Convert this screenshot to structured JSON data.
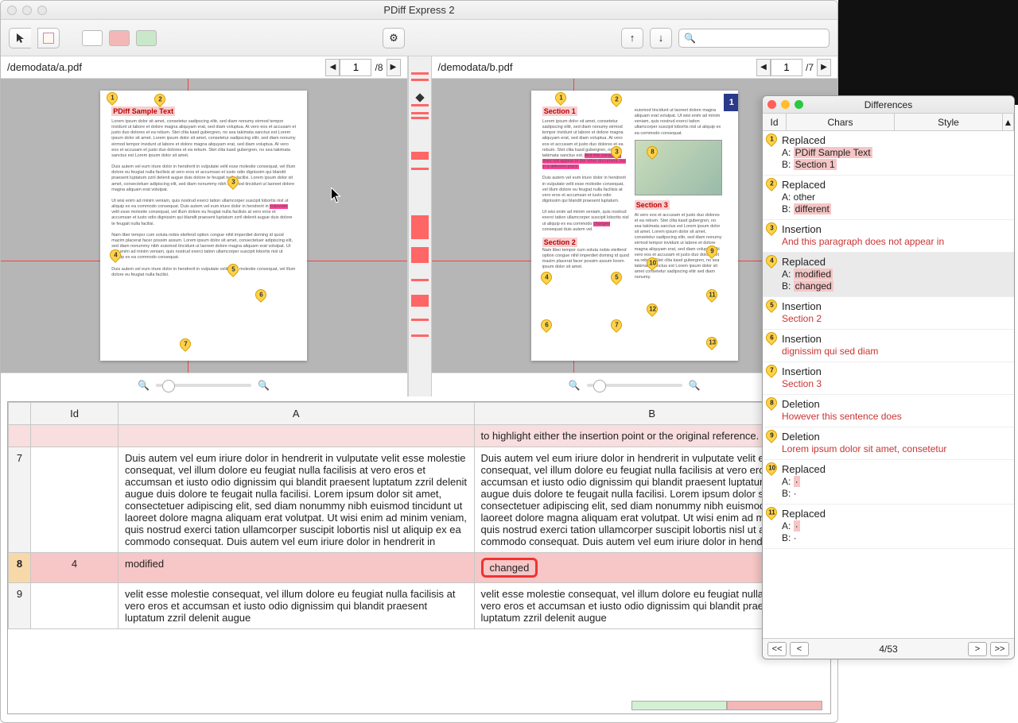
{
  "window": {
    "title": "PDiff Express 2"
  },
  "toolbar": {
    "swatches": [
      "#ffffff",
      "#f4b7b7",
      "#c9e8c9"
    ],
    "search_placeholder": ""
  },
  "docA": {
    "path": "/demodata/a.pdf",
    "page": "1",
    "total": "/8",
    "title": "PDiff Sample Text"
  },
  "docB": {
    "path": "/demodata/b.pdf",
    "page": "1",
    "total": "/7",
    "titles": [
      "Section 1",
      "Section 2",
      "Section 3"
    ]
  },
  "markersA": [
    1,
    2,
    3,
    4,
    5,
    6,
    7
  ],
  "markersB": [
    1,
    2,
    3,
    4,
    5,
    6,
    7,
    8,
    9,
    10,
    11,
    12,
    13
  ],
  "table": {
    "headers": {
      "id": "Id",
      "a": "A",
      "b": "B"
    },
    "rows": [
      {
        "num": "",
        "id": "",
        "a": "",
        "b": "to highlight either the insertion point or the original reference.",
        "cls": "pink"
      },
      {
        "num": "7",
        "id": "",
        "a": "Duis autem vel eum iriure dolor in hendrerit in vulputate velit esse molestie consequat, vel illum dolore eu feugiat nulla facilisis at vero eros et accumsan et iusto odio dignissim qui blandit praesent luptatum zzril delenit augue duis dolore te feugait nulla facilisi. Lorem ipsum dolor sit amet, consectetuer adipiscing elit, sed diam nonummy nibh euismod tincidunt ut laoreet dolore magna aliquam erat volutpat. Ut wisi enim ad minim veniam, quis nostrud exerci tation ullamcorper suscipit lobortis nisl ut aliquip ex ea commodo consequat. Duis autem vel eum iriure dolor in hendrerit in",
        "b": "Duis autem vel eum iriure dolor in hendrerit in vulputate velit esse molestie consequat, vel illum dolore eu feugiat nulla facilisis at vero eros et accumsan et iusto odio dignissim qui blandit praesent luptatum zzril delenit augue duis dolore te feugait nulla facilisi. Lorem ipsum dolor sit amet, consectetuer adipiscing elit, sed diam nonummy nibh euismod tincidunt ut laoreet dolore magna aliquam erat volutpat. Ut wisi enim ad minim veniam, quis nostrud exerci tation ullamcorper suscipit lobortis nisl ut aliquip ex ea commodo consequat. Duis autem vel eum iriure dolor in hendrerit in",
        "cls": ""
      },
      {
        "num": "8",
        "id": "4",
        "a": "modified",
        "b": "changed",
        "cls": "selected"
      },
      {
        "num": "9",
        "id": "",
        "a": "velit esse molestie consequat, vel illum dolore eu feugiat nulla facilisis at vero eros et accumsan et iusto odio dignissim qui blandit praesent luptatum zzril delenit augue",
        "b": "velit esse molestie consequat, vel illum dolore eu feugiat nulla facilisis at vero eros et accumsan et iusto odio dignissim qui blandit praesent luptatum zzril delenit augue",
        "cls": ""
      }
    ]
  },
  "diffpanel": {
    "title": "Differences",
    "tabs": {
      "id": "Id",
      "chars": "Chars",
      "style": "Style"
    },
    "items": [
      {
        "n": "1",
        "kind": "Replaced",
        "lines": [
          {
            "t": "A: ",
            "v": "PDiff Sample Text",
            "hl": true
          },
          {
            "t": "B: ",
            "v": "Section 1",
            "hl": true
          }
        ]
      },
      {
        "n": "2",
        "kind": "Replaced",
        "lines": [
          {
            "t": "A: ",
            "v": "other",
            "hl": false
          },
          {
            "t": "B: ",
            "v": "different",
            "hl": true
          }
        ]
      },
      {
        "n": "3",
        "kind": "Insertion",
        "lines": [
          {
            "red": true,
            "v": "And this paragraph does not appear in"
          }
        ]
      },
      {
        "n": "4",
        "kind": "Replaced",
        "selected": true,
        "lines": [
          {
            "t": "A: ",
            "v": "modified",
            "hl": true
          },
          {
            "t": "B: ",
            "v": "changed",
            "hl": true
          }
        ]
      },
      {
        "n": "5",
        "kind": "Insertion",
        "lines": [
          {
            "red": true,
            "v": "Section 2"
          }
        ]
      },
      {
        "n": "6",
        "kind": "Insertion",
        "lines": [
          {
            "red": true,
            "v": "dignissim qui sed diam"
          }
        ]
      },
      {
        "n": "7",
        "kind": "Insertion",
        "lines": [
          {
            "red": true,
            "v": "Section 3"
          }
        ]
      },
      {
        "n": "8",
        "kind": "Deletion",
        "lines": [
          {
            "red": true,
            "v": "However this sentence does"
          }
        ]
      },
      {
        "n": "9",
        "kind": "Deletion",
        "lines": [
          {
            "red": true,
            "v": "Lorem ipsum dolor sit amet, consetetur"
          }
        ]
      },
      {
        "n": "10",
        "kind": "Replaced",
        "lines": [
          {
            "t": "A: ",
            "v": "·",
            "hl": true
          },
          {
            "t": "B: ",
            "v": "·",
            "hl": false
          }
        ]
      },
      {
        "n": "11",
        "kind": "Replaced",
        "lines": [
          {
            "t": "A: ",
            "v": "·",
            "hl": true
          },
          {
            "t": "B: ",
            "v": "·",
            "hl": false
          }
        ]
      }
    ],
    "nav": {
      "first": "<<",
      "prev": "<",
      "pos": "4/53",
      "next": ">",
      "last": ">>"
    }
  }
}
